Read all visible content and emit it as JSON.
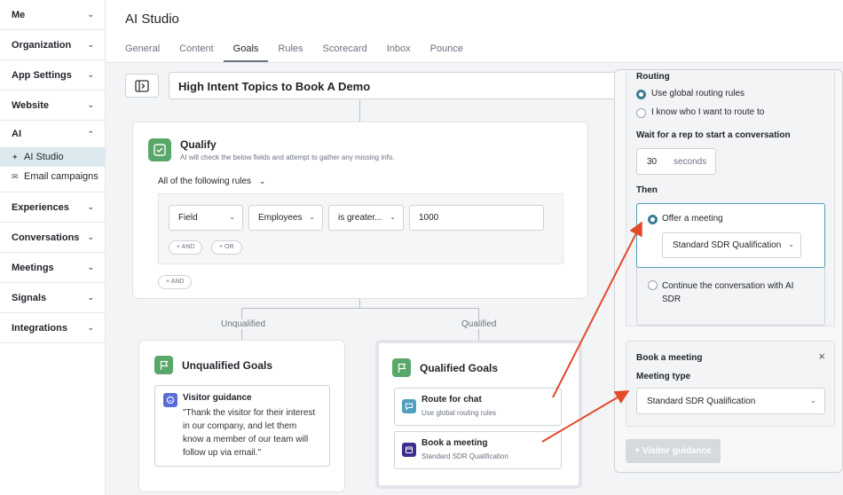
{
  "sidebar": {
    "sections_top": [
      {
        "label": "Me"
      },
      {
        "label": "Organization"
      },
      {
        "label": "App Settings"
      },
      {
        "label": "Website"
      }
    ],
    "ai": {
      "label": "AI",
      "items": [
        {
          "label": "AI Studio",
          "icon": "sparkle-icon",
          "active": true
        },
        {
          "label": "Email campaigns",
          "icon": "mail-icon",
          "active": false
        }
      ]
    },
    "sections_bottom": [
      {
        "label": "Experiences"
      },
      {
        "label": "Conversations"
      },
      {
        "label": "Meetings"
      },
      {
        "label": "Signals"
      },
      {
        "label": "Integrations"
      }
    ]
  },
  "header": {
    "title": "AI Studio",
    "tabs": [
      "General",
      "Content",
      "Goals",
      "Rules",
      "Scorecard",
      "Inbox",
      "Pounce"
    ],
    "active_tab": "Goals"
  },
  "flow": {
    "name": "High Intent Topics to Book A Demo",
    "qualify": {
      "title": "Qualify",
      "subtitle": "AI will check the below fields and attempt to gather any missing info.",
      "rule_mode": "All of the following rules",
      "rule": {
        "field_type": "Field",
        "field": "Employees",
        "operator": "is greater...",
        "value": "1000"
      },
      "and_btn": "+ AND",
      "or_btn": "+ OR",
      "outer_and_btn": "+ AND"
    },
    "branches": {
      "unqualified": "Unqualified",
      "qualified": "Qualified"
    },
    "unqualified_goals": {
      "title": "Unqualified Goals",
      "item_title": "Visitor guidance",
      "item_text_1": "\"Thank the visitor for their interest",
      "item_text_2": "in our company, and let them",
      "item_text_3": "know a member of our team will",
      "item_text_4": "follow up via email.\""
    },
    "qualified_goals": {
      "title": "Qualified Goals",
      "items": [
        {
          "title": "Route for chat",
          "subtitle": "Use global routing rules"
        },
        {
          "title": "Book a meeting",
          "subtitle": "Standard SDR Qualification"
        }
      ]
    }
  },
  "panel": {
    "routing_label": "Routing",
    "routing_options": [
      {
        "label": "Use global routing rules",
        "selected": true
      },
      {
        "label": "I know who I want to route to",
        "selected": false
      }
    ],
    "wait_label": "Wait for a rep to start a conversation",
    "wait_value": "30",
    "wait_unit": "seconds",
    "then_label": "Then",
    "then_options": [
      {
        "label": "Offer a meeting",
        "selected": true
      },
      {
        "label": "Continue the conversation with AI",
        "label2": "SDR",
        "selected": false
      }
    ],
    "offer_select_value": "Standard SDR Qualification",
    "book": {
      "title": "Book a meeting",
      "meeting_type_label": "Meeting type",
      "meeting_type_value": "Standard SDR Qualification"
    },
    "visitor_guidance_btn": "+ Visitor guidance"
  },
  "colors": {
    "accent_green": "#5aa76a",
    "arrow_red": "#e4492a",
    "radio_teal": "#3e7d93"
  }
}
